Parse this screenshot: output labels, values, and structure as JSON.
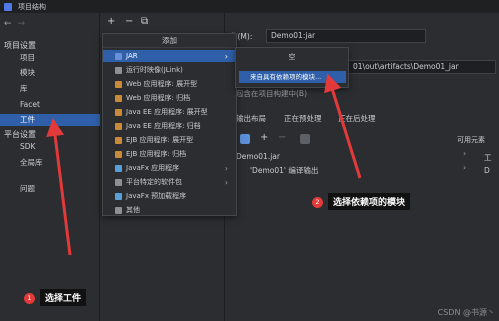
{
  "window": {
    "title": "项目结构"
  },
  "sidebar": {
    "project_settings_heading": "项目设置",
    "project_items": [
      "项目",
      "模块",
      "库",
      "Facet",
      "工件"
    ],
    "platform_settings_heading": "平台设置",
    "platform_items": [
      "SDK",
      "全局库"
    ],
    "problems": "问题"
  },
  "toolbar": {
    "add": "+",
    "remove": "−",
    "copy": "⧉"
  },
  "add_menu": {
    "header": "添加",
    "items": [
      {
        "label": "JAR",
        "has_submenu": true,
        "selected": true,
        "icon_color": "#6b8fd6"
      },
      {
        "label": "运行时映像(JLink)",
        "has_submenu": false,
        "icon_color": "#8c8f94"
      },
      {
        "label": "Web 应用程序: 展开型",
        "has_submenu": false,
        "icon_color": "#c98b3a"
      },
      {
        "label": "Web 应用程序: 归档",
        "has_submenu": false,
        "icon_color": "#c98b3a"
      },
      {
        "label": "Java EE 应用程序: 展开型",
        "has_submenu": false,
        "icon_color": "#c98b3a"
      },
      {
        "label": "Java EE 应用程序: 归档",
        "has_submenu": false,
        "icon_color": "#c98b3a"
      },
      {
        "label": "EJB 应用程序: 展开型",
        "has_submenu": false,
        "icon_color": "#c98b3a"
      },
      {
        "label": "EJB 应用程序: 归档",
        "has_submenu": false,
        "icon_color": "#c98b3a"
      },
      {
        "label": "JavaFx 应用程序",
        "has_submenu": true,
        "icon_color": "#5aa0d8"
      },
      {
        "label": "平台特定的软件包",
        "has_submenu": true,
        "icon_color": "#8c8f94"
      },
      {
        "label": "JavaFx 预加载程序",
        "has_submenu": false,
        "icon_color": "#5aa0d8"
      },
      {
        "label": "其他",
        "has_submenu": false,
        "icon_color": "#8c8f94"
      }
    ]
  },
  "submenu": {
    "empty_label": "空",
    "selected_label": "来自具有依赖项的模块..."
  },
  "right": {
    "name_label": "称(M):",
    "name_value": "Demo01:jar",
    "output_path": "01\\out\\artifacts\\Demo01_jar",
    "include_checkbox": "包含在项目构建中(B)",
    "tabs": [
      "输出布局",
      "正在预处理",
      "正在后处理"
    ],
    "available_elements": "可用元素",
    "tree": [
      "Demo01.jar",
      "'Demo01' 编译输出"
    ],
    "right_tree": [
      "工",
      "D"
    ]
  },
  "annotations": {
    "one_badge": "1",
    "one_text": "选择工件",
    "two_badge": "2",
    "two_text": "选择依赖项的模块"
  },
  "watermark": "CSDN @书源丶",
  "colors": {
    "accent": "#2e5fa8",
    "arrow": "#e23a3a"
  }
}
